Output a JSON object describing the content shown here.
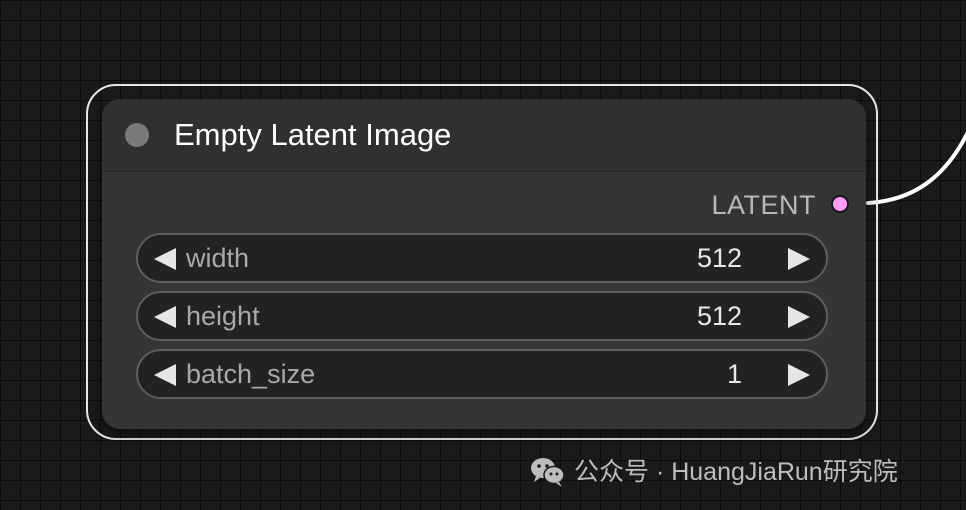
{
  "node": {
    "title": "Empty Latent Image",
    "collapse_icon": "circle-dot-icon",
    "output": {
      "label": "LATENT",
      "slot_color": "#ff9cf9"
    },
    "widgets": [
      {
        "label": "width",
        "value": "512"
      },
      {
        "label": "height",
        "value": "512"
      },
      {
        "label": "batch_size",
        "value": "1"
      }
    ]
  },
  "colors": {
    "background": "#1a1a1a",
    "node_body": "#353535",
    "node_header": "#303030",
    "link": "#ffffff",
    "selection": "#e8e8e8"
  },
  "watermark": {
    "icon": "wechat-icon",
    "text": "公众号 · HuangJiaRun研究院"
  }
}
